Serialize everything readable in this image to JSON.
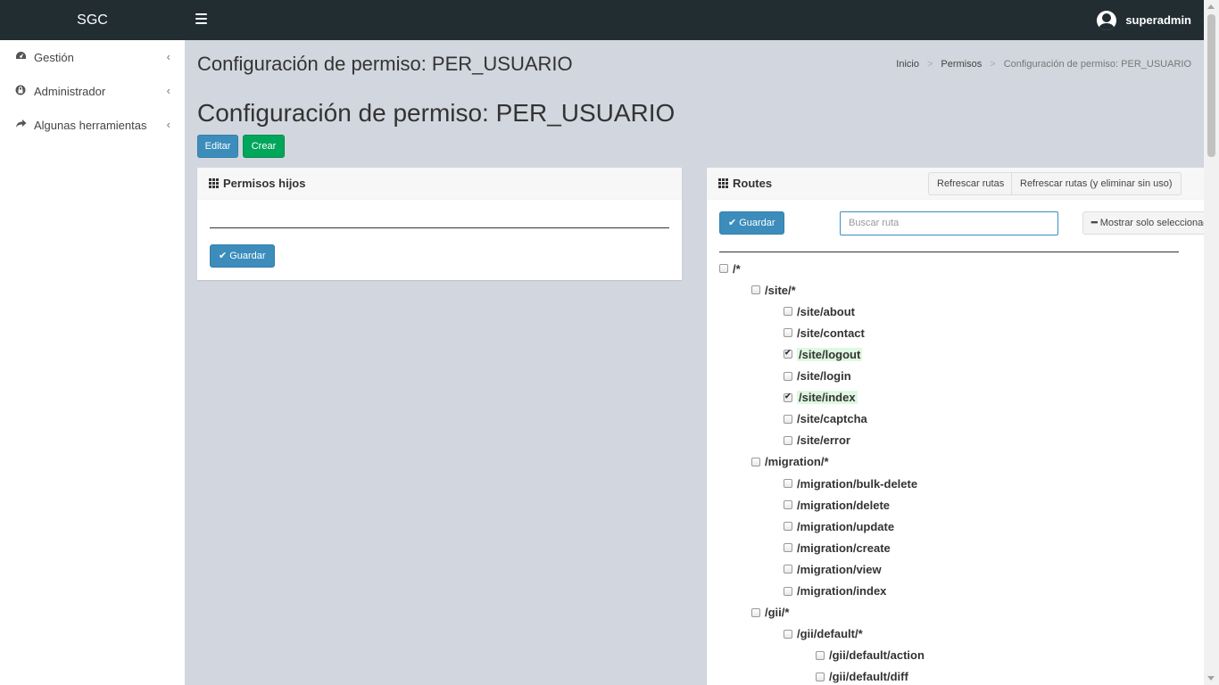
{
  "app": {
    "logo": "SGC",
    "user": "superadmin"
  },
  "sidebar": {
    "items": [
      {
        "label": "Gestión",
        "icon": "dashboard-icon"
      },
      {
        "label": "Administrador",
        "icon": "lock-icon"
      },
      {
        "label": "Algunas herramientas",
        "icon": "share-icon"
      }
    ]
  },
  "page": {
    "header_title": "Configuración de permiso: PER_USUARIO",
    "breadcrumb": [
      "Inicio",
      "Permisos",
      "Configuración de permiso: PER_USUARIO"
    ],
    "title": "Configuración de permiso: PER_USUARIO",
    "edit_label": "Editar",
    "create_label": "Crear"
  },
  "left_box": {
    "title": "Permisos hijos",
    "save_label": "Guardar"
  },
  "right_box": {
    "title": "Routes",
    "refresh_label": "Refrescar rutas",
    "refresh_delete_label": "Refrescar rutas (y eliminar sin uso)",
    "save_label": "Guardar",
    "search_placeholder": "Buscar ruta",
    "show_selected_label": "Mostrar solo seleccionados"
  },
  "routes": [
    {
      "label": "/*",
      "level": 0,
      "checked": false
    },
    {
      "label": "/site/*",
      "level": 1,
      "checked": false
    },
    {
      "label": "/site/about",
      "level": 2,
      "checked": false
    },
    {
      "label": "/site/contact",
      "level": 2,
      "checked": false
    },
    {
      "label": "/site/logout",
      "level": 2,
      "checked": true
    },
    {
      "label": "/site/login",
      "level": 2,
      "checked": false
    },
    {
      "label": "/site/index",
      "level": 2,
      "checked": true
    },
    {
      "label": "/site/captcha",
      "level": 2,
      "checked": false
    },
    {
      "label": "/site/error",
      "level": 2,
      "checked": false
    },
    {
      "label": "/migration/*",
      "level": 1,
      "checked": false
    },
    {
      "label": "/migration/bulk-delete",
      "level": 2,
      "checked": false
    },
    {
      "label": "/migration/delete",
      "level": 2,
      "checked": false
    },
    {
      "label": "/migration/update",
      "level": 2,
      "checked": false
    },
    {
      "label": "/migration/create",
      "level": 2,
      "checked": false
    },
    {
      "label": "/migration/view",
      "level": 2,
      "checked": false
    },
    {
      "label": "/migration/index",
      "level": 2,
      "checked": false
    },
    {
      "label": "/gii/*",
      "level": 1,
      "checked": false
    },
    {
      "label": "/gii/default/*",
      "level": 2,
      "checked": false
    },
    {
      "label": "/gii/default/action",
      "level": 3,
      "checked": false
    },
    {
      "label": "/gii/default/diff",
      "level": 3,
      "checked": false
    }
  ]
}
